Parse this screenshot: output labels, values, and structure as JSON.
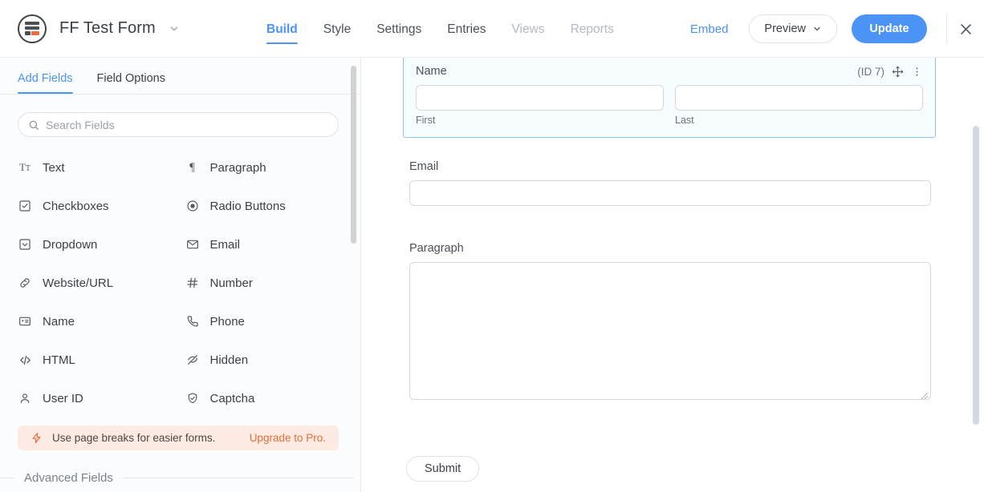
{
  "header": {
    "logo_icon": "formidable-logo-icon",
    "form_title": "FF Test Form",
    "title_caret_icon": "chevron-down-icon",
    "tabs": [
      {
        "label": "Build",
        "state": "active"
      },
      {
        "label": "Style",
        "state": "normal"
      },
      {
        "label": "Settings",
        "state": "normal"
      },
      {
        "label": "Entries",
        "state": "normal"
      },
      {
        "label": "Views",
        "state": "muted"
      },
      {
        "label": "Reports",
        "state": "muted"
      }
    ],
    "embed_label": "Embed",
    "preview_label": "Preview",
    "preview_caret_icon": "chevron-down-icon",
    "update_label": "Update",
    "close_icon": "close-icon"
  },
  "sidebar": {
    "tabs": [
      {
        "label": "Add Fields",
        "state": "active"
      },
      {
        "label": "Field Options",
        "state": "normal"
      }
    ],
    "search": {
      "placeholder": "Search Fields",
      "value": "",
      "icon": "search-icon"
    },
    "fields": [
      {
        "label": "Text",
        "icon": "text-icon"
      },
      {
        "label": "Paragraph",
        "icon": "paragraph-icon"
      },
      {
        "label": "Checkboxes",
        "icon": "checkbox-icon"
      },
      {
        "label": "Radio Buttons",
        "icon": "radio-icon"
      },
      {
        "label": "Dropdown",
        "icon": "dropdown-icon"
      },
      {
        "label": "Email",
        "icon": "envelope-icon"
      },
      {
        "label": "Website/URL",
        "icon": "link-icon"
      },
      {
        "label": "Number",
        "icon": "hash-icon"
      },
      {
        "label": "Name",
        "icon": "id-card-icon"
      },
      {
        "label": "Phone",
        "icon": "phone-icon"
      },
      {
        "label": "HTML",
        "icon": "code-icon"
      },
      {
        "label": "Hidden",
        "icon": "eye-off-icon"
      },
      {
        "label": "User ID",
        "icon": "user-icon"
      },
      {
        "label": "Captcha",
        "icon": "shield-check-icon"
      }
    ],
    "promo": {
      "icon": "lightning-bolt-icon",
      "text": "Use page breaks for easier forms.",
      "link": "Upgrade to Pro."
    },
    "advanced_section_label": "Advanced Fields"
  },
  "canvas": {
    "name_field": {
      "label": "Name",
      "id_label": "(ID 7)",
      "move_icon": "move-arrows-icon",
      "menu_icon": "vertical-dots-icon",
      "first": {
        "sublabel": "First",
        "value": ""
      },
      "last": {
        "sublabel": "Last",
        "value": ""
      }
    },
    "email_field": {
      "label": "Email",
      "value": ""
    },
    "paragraph_field": {
      "label": "Paragraph",
      "value": ""
    },
    "submit_label": "Submit"
  },
  "colors": {
    "accent_blue": "#4b93f5",
    "selected_border": "#8ec4e4",
    "selected_bg": "#f6fbfe",
    "promo_bg": "#fdeae2",
    "promo_orange": "#e4703c",
    "logo_orange": "#ef6c3c"
  }
}
